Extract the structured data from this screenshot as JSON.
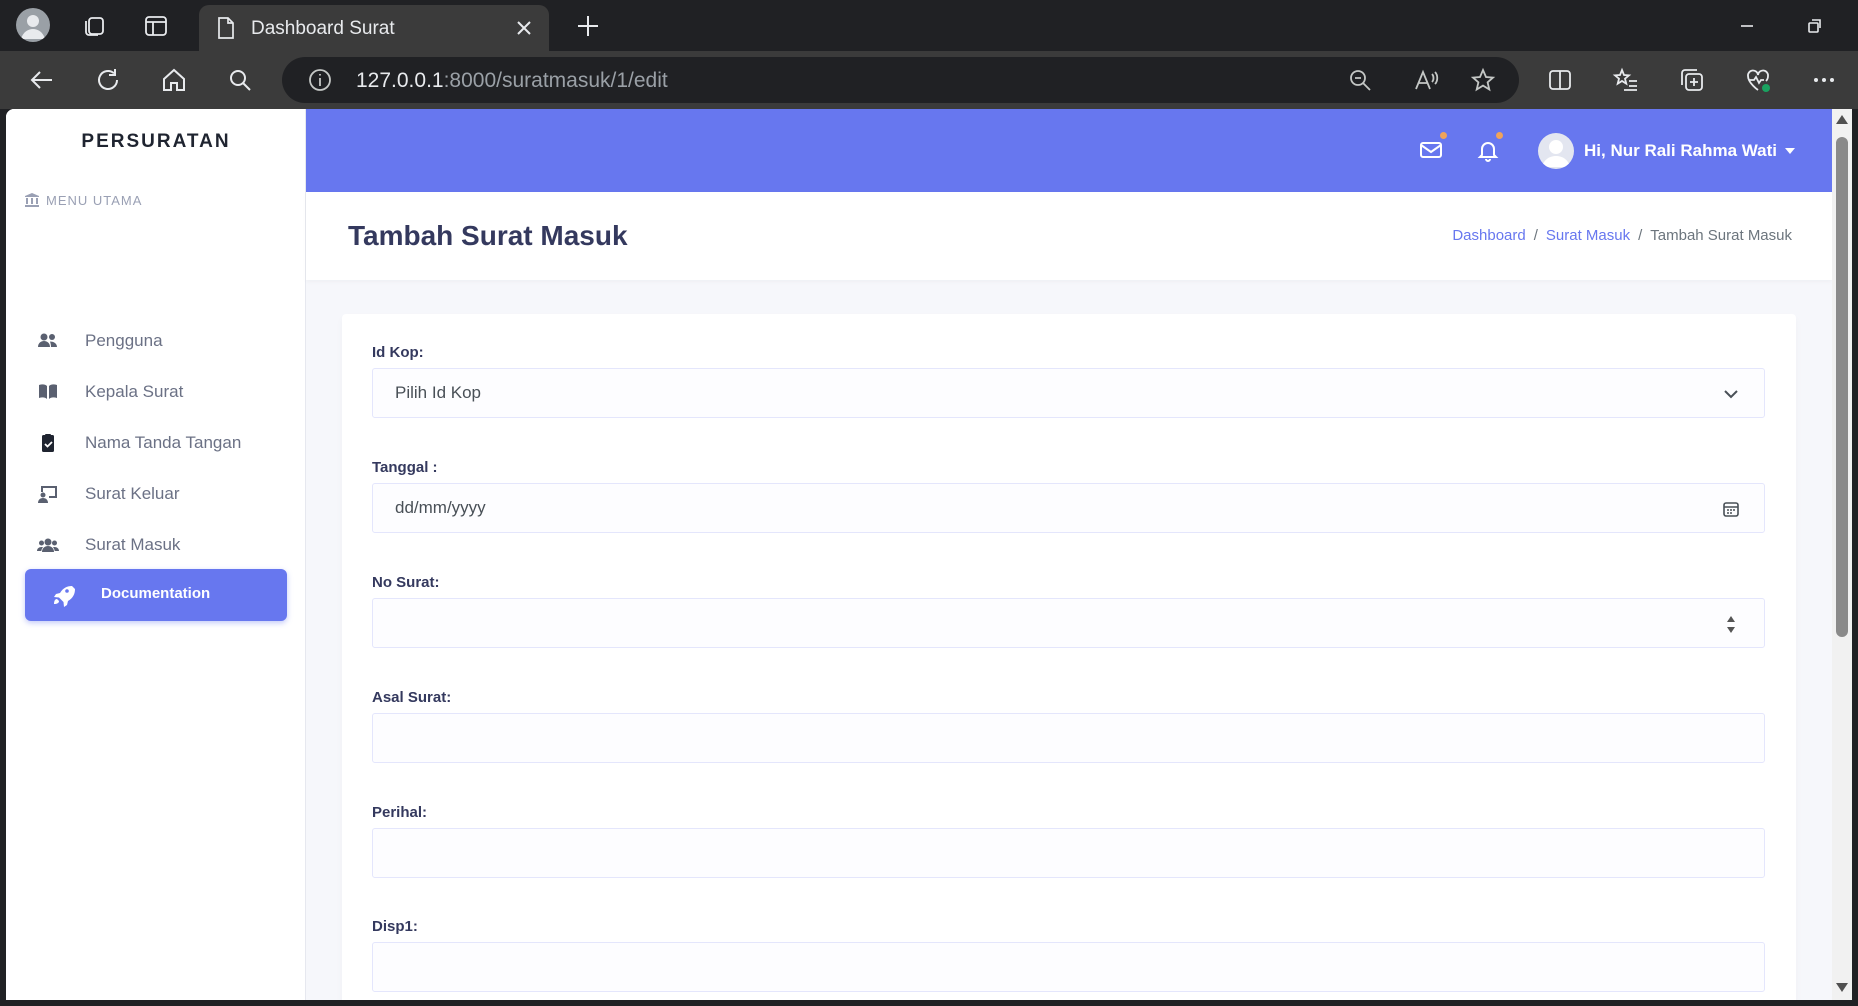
{
  "browser": {
    "tab_title": "Dashboard Surat",
    "url_host": "127.0.0.1",
    "url_rest": ":8000/suratmasuk/1/edit"
  },
  "sidebar": {
    "brand": "PERSURATAN",
    "menu_heading": "MENU UTAMA",
    "items": [
      {
        "label": "Pengguna",
        "icon": "users-icon"
      },
      {
        "label": "Kepala Surat",
        "icon": "book-icon"
      },
      {
        "label": "Nama Tanda Tangan",
        "icon": "clipboard-check-icon"
      },
      {
        "label": "Surat Keluar",
        "icon": "chalkboard-icon"
      },
      {
        "label": "Surat Masuk",
        "icon": "users-group-icon"
      }
    ],
    "doc_button": "Documentation"
  },
  "header": {
    "user_name": "Hi, Nur Rali Rahma Wati"
  },
  "page": {
    "title": "Tambah Surat Masuk",
    "breadcrumb": [
      "Dashboard",
      "Surat Masuk",
      "Tambah Surat Masuk"
    ]
  },
  "form": {
    "fields": [
      {
        "label": "Id Kop:",
        "value": "Pilih Id Kop",
        "type": "select"
      },
      {
        "label": "Tanggal :",
        "value": "dd/mm/yyyy",
        "type": "date"
      },
      {
        "label": "No Surat:",
        "value": "",
        "type": "number"
      },
      {
        "label": "Asal Surat:",
        "value": "",
        "type": "text"
      },
      {
        "label": "Perihal:",
        "value": "",
        "type": "text"
      },
      {
        "label": "Disp1:",
        "value": "",
        "type": "text"
      }
    ]
  },
  "colors": {
    "primary": "#6777ef",
    "title": "#34395e",
    "browser_dark": "#202124"
  }
}
